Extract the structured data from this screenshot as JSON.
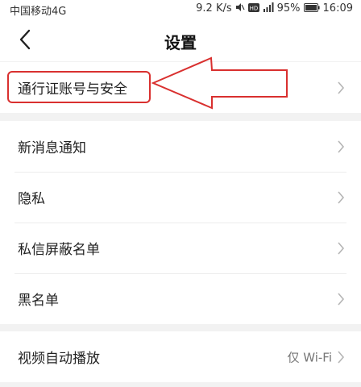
{
  "status_bar": {
    "carrier": "中国移动4G",
    "speed": "9.2 K/s",
    "battery": "95%",
    "time": "16:09",
    "icons": [
      "mute-icon",
      "hd-icon",
      "signal-icon",
      "battery-icon"
    ]
  },
  "header": {
    "title": "设置",
    "back_icon": "chevron-left-icon"
  },
  "groups": [
    {
      "items": [
        {
          "label": "通行证账号与安全"
        }
      ]
    },
    {
      "items": [
        {
          "label": "新消息通知"
        },
        {
          "label": "隐私"
        },
        {
          "label": "私信屏蔽名单"
        },
        {
          "label": "黑名单"
        }
      ]
    },
    {
      "items": [
        {
          "label": "视频自动播放",
          "value": "仅 Wi-Fi"
        }
      ]
    }
  ],
  "annotation": {
    "highlight_color": "#d9302f",
    "arrow_color": "#d9302f"
  },
  "colors": {
    "background": "#f2f2f2",
    "card": "#ffffff",
    "chevron": "#b5b5b5"
  }
}
